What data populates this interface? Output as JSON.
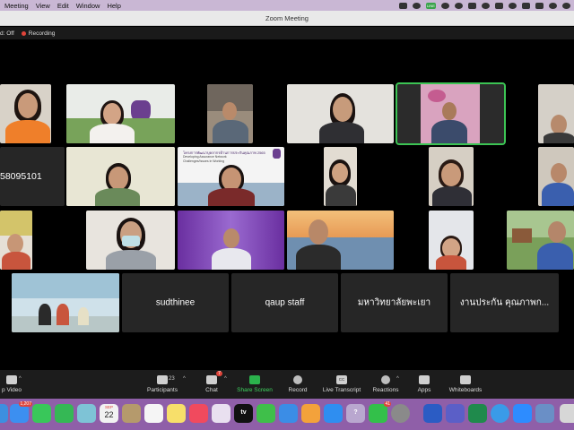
{
  "menubar": {
    "items": [
      "Meeting",
      "View",
      "Edit",
      "Window",
      "Help"
    ],
    "status_text": "LINE"
  },
  "window": {
    "title": "Zoom Meeting"
  },
  "meeting_bar": {
    "captions": "d: Off",
    "recording": "Recording"
  },
  "tiles": {
    "t_number": "58095101",
    "sudthinee": "sudthinee",
    "qaup": "qaup staff",
    "thai1": "มหาวิทยาลัยพะเยา",
    "thai2": "งานประกัน คุณภาพก..."
  },
  "slide_text": {
    "line1": "โครงการพัฒนาบุคลากรด้านการประกันคุณภาพ 2565",
    "line2": "Developing Assurance Network",
    "line3": "Challenges/Issues in Working"
  },
  "toolbar": {
    "video": "p Video",
    "participants": "Participants",
    "participants_count": "23",
    "chat": "Chat",
    "chat_badge": "7",
    "share": "Share Screen",
    "record": "Record",
    "transcript": "Live Transcript",
    "transcript_icon": "CC",
    "reactions": "Reactions",
    "apps": "Apps",
    "whiteboards": "Whiteboards"
  },
  "dock": {
    "mail_badge": "1,207",
    "calendar_month": "SEP",
    "calendar_day": "22",
    "line_badge": "41",
    "tv_label": "tv",
    "help_label": "?"
  },
  "colors": {
    "menubar": "#c9b7d4",
    "active_speaker": "#3cc454",
    "share_green": "#2bb24c",
    "record_red": "#e0443a",
    "dock": "#8f5fa8"
  }
}
